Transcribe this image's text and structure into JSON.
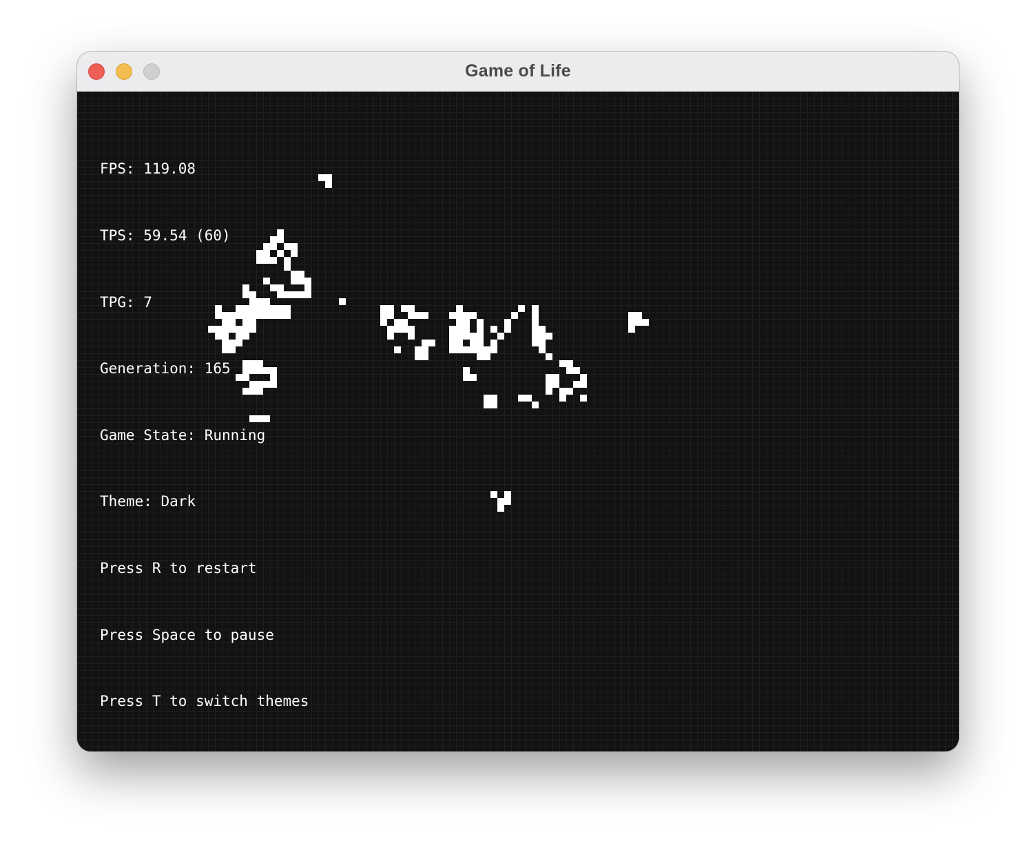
{
  "window": {
    "title": "Game of Life",
    "controls": [
      "close",
      "minimize",
      "maximize"
    ]
  },
  "hud": {
    "fps": "FPS: 119.08",
    "tps": "TPS: 59.54 (60)",
    "tpg": "TPG: 7",
    "generation": "Generation: 165",
    "game_state": "Game State: Running",
    "theme": "Theme: Dark",
    "hint_restart": "Press R to restart",
    "hint_pause": "Press Space to pause",
    "hint_theme": "Press T to switch themes"
  },
  "board": {
    "theme": "Dark",
    "generation": 165,
    "colors": {
      "background": "#121212",
      "grid": "#1f1f1f",
      "live_cell": "#ffffff",
      "text": "#ffffff"
    },
    "live_cells": [
      [
        35,
        12
      ],
      [
        36,
        12
      ],
      [
        36,
        13
      ],
      [
        29,
        20
      ],
      [
        28,
        21
      ],
      [
        29,
        21
      ],
      [
        27,
        22
      ],
      [
        28,
        22
      ],
      [
        30,
        22
      ],
      [
        31,
        22
      ],
      [
        26,
        23
      ],
      [
        27,
        23
      ],
      [
        29,
        23
      ],
      [
        31,
        23
      ],
      [
        26,
        24
      ],
      [
        27,
        24
      ],
      [
        28,
        24
      ],
      [
        30,
        24
      ],
      [
        30,
        25
      ],
      [
        31,
        26
      ],
      [
        32,
        26
      ],
      [
        27,
        27
      ],
      [
        31,
        27
      ],
      [
        32,
        27
      ],
      [
        33,
        27
      ],
      [
        24,
        28
      ],
      [
        28,
        28
      ],
      [
        29,
        28
      ],
      [
        33,
        28
      ],
      [
        24,
        29
      ],
      [
        25,
        29
      ],
      [
        29,
        29
      ],
      [
        30,
        29
      ],
      [
        31,
        29
      ],
      [
        32,
        29
      ],
      [
        33,
        29
      ],
      [
        25,
        30
      ],
      [
        26,
        30
      ],
      [
        27,
        30
      ],
      [
        38,
        30
      ],
      [
        20,
        31
      ],
      [
        23,
        31
      ],
      [
        24,
        31
      ],
      [
        25,
        31
      ],
      [
        26,
        31
      ],
      [
        27,
        31
      ],
      [
        28,
        31
      ],
      [
        29,
        31
      ],
      [
        30,
        31
      ],
      [
        44,
        31
      ],
      [
        45,
        31
      ],
      [
        47,
        31
      ],
      [
        48,
        31
      ],
      [
        55,
        31
      ],
      [
        64,
        31
      ],
      [
        66,
        31
      ],
      [
        20,
        32
      ],
      [
        21,
        32
      ],
      [
        22,
        32
      ],
      [
        23,
        32
      ],
      [
        24,
        32
      ],
      [
        25,
        32
      ],
      [
        26,
        32
      ],
      [
        27,
        32
      ],
      [
        28,
        32
      ],
      [
        29,
        32
      ],
      [
        30,
        32
      ],
      [
        44,
        32
      ],
      [
        45,
        32
      ],
      [
        48,
        32
      ],
      [
        49,
        32
      ],
      [
        50,
        32
      ],
      [
        54,
        32
      ],
      [
        55,
        32
      ],
      [
        56,
        32
      ],
      [
        57,
        32
      ],
      [
        63,
        32
      ],
      [
        66,
        32
      ],
      [
        21,
        33
      ],
      [
        22,
        33
      ],
      [
        24,
        33
      ],
      [
        25,
        33
      ],
      [
        44,
        33
      ],
      [
        46,
        33
      ],
      [
        47,
        33
      ],
      [
        55,
        33
      ],
      [
        56,
        33
      ],
      [
        58,
        33
      ],
      [
        62,
        33
      ],
      [
        66,
        33
      ],
      [
        19,
        34
      ],
      [
        20,
        34
      ],
      [
        21,
        34
      ],
      [
        22,
        34
      ],
      [
        23,
        34
      ],
      [
        24,
        34
      ],
      [
        25,
        34
      ],
      [
        45,
        34
      ],
      [
        46,
        34
      ],
      [
        47,
        34
      ],
      [
        48,
        34
      ],
      [
        54,
        34
      ],
      [
        55,
        34
      ],
      [
        56,
        34
      ],
      [
        58,
        34
      ],
      [
        60,
        34
      ],
      [
        62,
        34
      ],
      [
        66,
        34
      ],
      [
        67,
        34
      ],
      [
        20,
        35
      ],
      [
        21,
        35
      ],
      [
        23,
        35
      ],
      [
        24,
        35
      ],
      [
        45,
        35
      ],
      [
        48,
        35
      ],
      [
        54,
        35
      ],
      [
        55,
        35
      ],
      [
        56,
        35
      ],
      [
        57,
        35
      ],
      [
        58,
        35
      ],
      [
        61,
        35
      ],
      [
        66,
        35
      ],
      [
        67,
        35
      ],
      [
        68,
        35
      ],
      [
        21,
        36
      ],
      [
        22,
        36
      ],
      [
        23,
        36
      ],
      [
        50,
        36
      ],
      [
        51,
        36
      ],
      [
        54,
        36
      ],
      [
        55,
        36
      ],
      [
        57,
        36
      ],
      [
        58,
        36
      ],
      [
        60,
        36
      ],
      [
        66,
        36
      ],
      [
        67,
        36
      ],
      [
        21,
        37
      ],
      [
        22,
        37
      ],
      [
        46,
        37
      ],
      [
        49,
        37
      ],
      [
        50,
        37
      ],
      [
        54,
        37
      ],
      [
        55,
        37
      ],
      [
        56,
        37
      ],
      [
        57,
        37
      ],
      [
        58,
        37
      ],
      [
        59,
        37
      ],
      [
        60,
        37
      ],
      [
        67,
        37
      ],
      [
        49,
        38
      ],
      [
        50,
        38
      ],
      [
        58,
        38
      ],
      [
        59,
        38
      ],
      [
        68,
        38
      ],
      [
        24,
        39
      ],
      [
        25,
        39
      ],
      [
        26,
        39
      ],
      [
        70,
        39
      ],
      [
        71,
        39
      ],
      [
        24,
        40
      ],
      [
        25,
        40
      ],
      [
        26,
        40
      ],
      [
        27,
        40
      ],
      [
        28,
        40
      ],
      [
        56,
        40
      ],
      [
        71,
        40
      ],
      [
        72,
        40
      ],
      [
        23,
        41
      ],
      [
        24,
        41
      ],
      [
        28,
        41
      ],
      [
        56,
        41
      ],
      [
        57,
        41
      ],
      [
        68,
        41
      ],
      [
        69,
        41
      ],
      [
        73,
        41
      ],
      [
        25,
        42
      ],
      [
        26,
        42
      ],
      [
        27,
        42
      ],
      [
        28,
        42
      ],
      [
        68,
        42
      ],
      [
        69,
        42
      ],
      [
        72,
        42
      ],
      [
        73,
        42
      ],
      [
        24,
        43
      ],
      [
        25,
        43
      ],
      [
        26,
        43
      ],
      [
        68,
        43
      ],
      [
        70,
        43
      ],
      [
        71,
        43
      ],
      [
        59,
        44
      ],
      [
        60,
        44
      ],
      [
        64,
        44
      ],
      [
        65,
        44
      ],
      [
        70,
        44
      ],
      [
        73,
        44
      ],
      [
        59,
        45
      ],
      [
        60,
        45
      ],
      [
        66,
        45
      ],
      [
        25,
        47
      ],
      [
        26,
        47
      ],
      [
        27,
        47
      ],
      [
        60,
        58
      ],
      [
        62,
        58
      ],
      [
        61,
        59
      ],
      [
        62,
        59
      ],
      [
        61,
        60
      ],
      [
        80,
        32
      ],
      [
        81,
        32
      ],
      [
        80,
        33
      ],
      [
        81,
        33
      ],
      [
        82,
        33
      ],
      [
        80,
        34
      ]
    ]
  }
}
